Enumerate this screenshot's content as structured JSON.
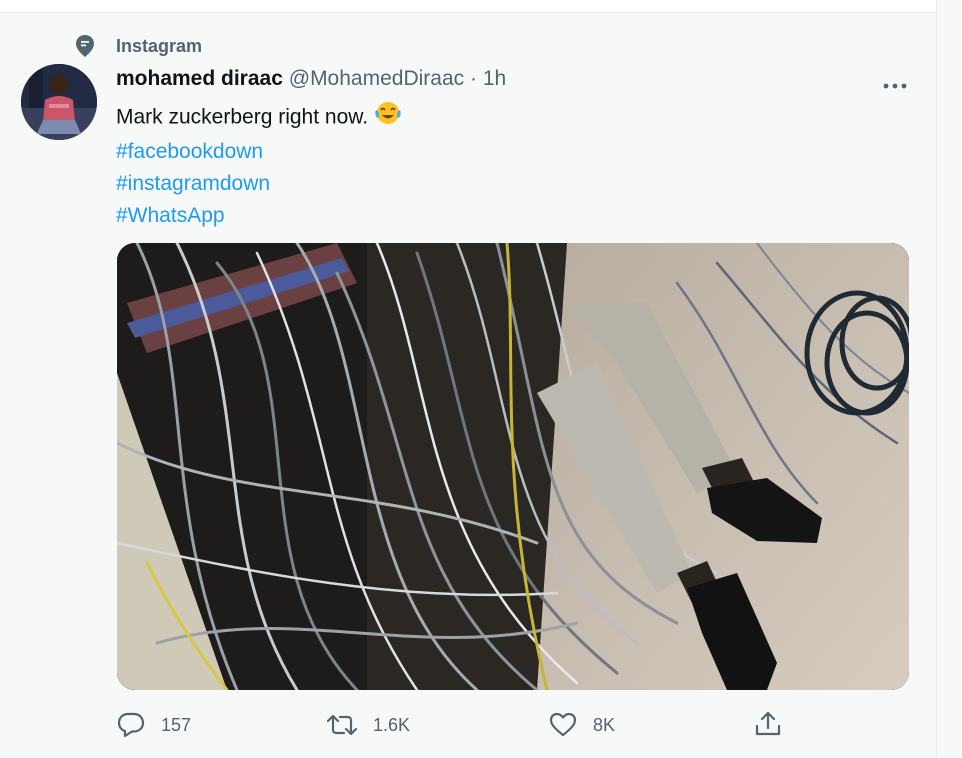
{
  "topic": {
    "label": "Instagram",
    "icon": "topic-icon"
  },
  "author": {
    "name": "mohamed diraac",
    "handle": "@MohamedDiraac",
    "separator": "·",
    "time": "1h"
  },
  "tweet": {
    "text": "Mark zuckerberg right now.",
    "emoji": "tears-of-joy-emoji",
    "hashtags": [
      "#facebookdown",
      "#instagramdown",
      "#WhatsApp"
    ]
  },
  "media": {
    "alt_icon": "photo-tangled-cables-legs"
  },
  "actions": {
    "reply": {
      "icon": "reply-icon",
      "count": "157"
    },
    "retweet": {
      "icon": "retweet-icon",
      "count": "1.6K"
    },
    "like": {
      "icon": "heart-icon",
      "count": "8K"
    },
    "share": {
      "icon": "share-icon"
    }
  },
  "colors": {
    "accent": "#1d9bf0",
    "text_primary": "#0f1419",
    "text_secondary": "#536471",
    "background": "#f7f9f9"
  }
}
